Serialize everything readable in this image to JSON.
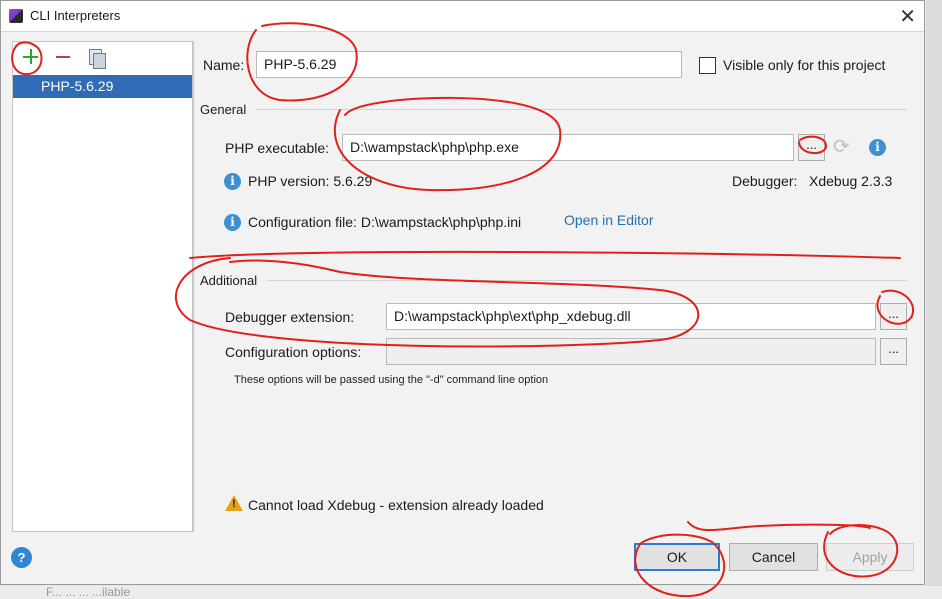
{
  "window": {
    "title": "CLI Interpreters",
    "close_glyph": "✕"
  },
  "sidebar": {
    "toolbar": {
      "add_icon": "plus-icon",
      "remove_icon": "minus-icon",
      "copy_icon": "copy-icon"
    },
    "items": [
      {
        "label": "PHP-5.6.29",
        "selected": true
      }
    ]
  },
  "form": {
    "name_label": "Name:",
    "name_value": "PHP-5.6.29",
    "visible_only_label": "Visible only for this project",
    "visible_only_checked": false,
    "general": {
      "title": "General",
      "php_exe_label": "PHP executable:",
      "php_exe_value": "D:\\wampstack\\php\\php.exe",
      "browse_label": "...",
      "php_version_label": "PHP version: 5.6.29",
      "debugger_label": "Debugger:",
      "debugger_value": "Xdebug 2.3.3",
      "config_file_label": "Configuration file: D:\\wampstack\\php\\php.ini",
      "open_in_editor": "Open in Editor"
    },
    "additional": {
      "title": "Additional",
      "debugger_ext_label": "Debugger extension:",
      "debugger_ext_value": "D:\\wampstack\\php\\ext\\php_xdebug.dll",
      "config_options_label": "Configuration options:",
      "config_options_value": "",
      "browse_label": "...",
      "hint": "These options will be passed using the \"-d\" command line option"
    },
    "warning": "Cannot load Xdebug - extension already loaded"
  },
  "buttons": {
    "help": "?",
    "ok": "OK",
    "cancel": "Cancel",
    "apply": "Apply"
  },
  "background": {
    "partial_text": "F... ... ... ...ilable"
  },
  "colors": {
    "selection": "#2f6cb5",
    "link": "#2470b3",
    "annotation": "#e0211b",
    "ok_border": "#2b7bd4"
  }
}
